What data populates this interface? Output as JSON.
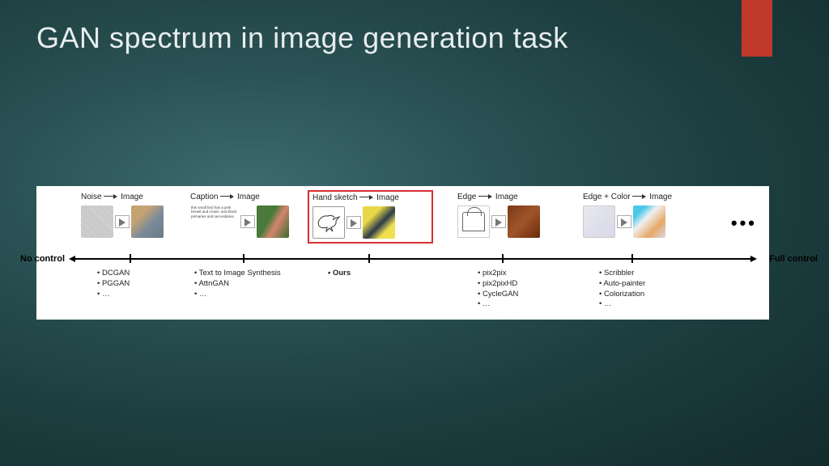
{
  "title": "GAN spectrum in image generation task",
  "axis": {
    "left": "No control",
    "right": "Full control"
  },
  "columns": [
    {
      "header_from": "Noise",
      "header_to": "Image",
      "caption_text": "",
      "methods": [
        "DCGAN",
        "PGGAN",
        "…"
      ],
      "highlight": false
    },
    {
      "header_from": "Caption",
      "header_to": "Image",
      "caption_text": "this small bird has a pink breast and crown, and black primaries and secondaries.",
      "methods": [
        "Text to Image Synthesis",
        "AttnGAN",
        "…"
      ],
      "highlight": false
    },
    {
      "header_from": "Hand sketch",
      "header_to": "Image",
      "caption_text": "",
      "methods": [
        "Ours"
      ],
      "highlight": true
    },
    {
      "header_from": "Edge",
      "header_to": "Image",
      "caption_text": "",
      "methods": [
        "pix2pix",
        "pix2pixHD",
        "CycleGAN",
        "…"
      ],
      "highlight": false
    },
    {
      "header_from": "Edge + Color",
      "header_to": "Image",
      "caption_text": "",
      "methods": [
        "Scribbler",
        "Auto-painter",
        "Colorization",
        "…"
      ],
      "highlight": false
    }
  ],
  "more": "•••"
}
